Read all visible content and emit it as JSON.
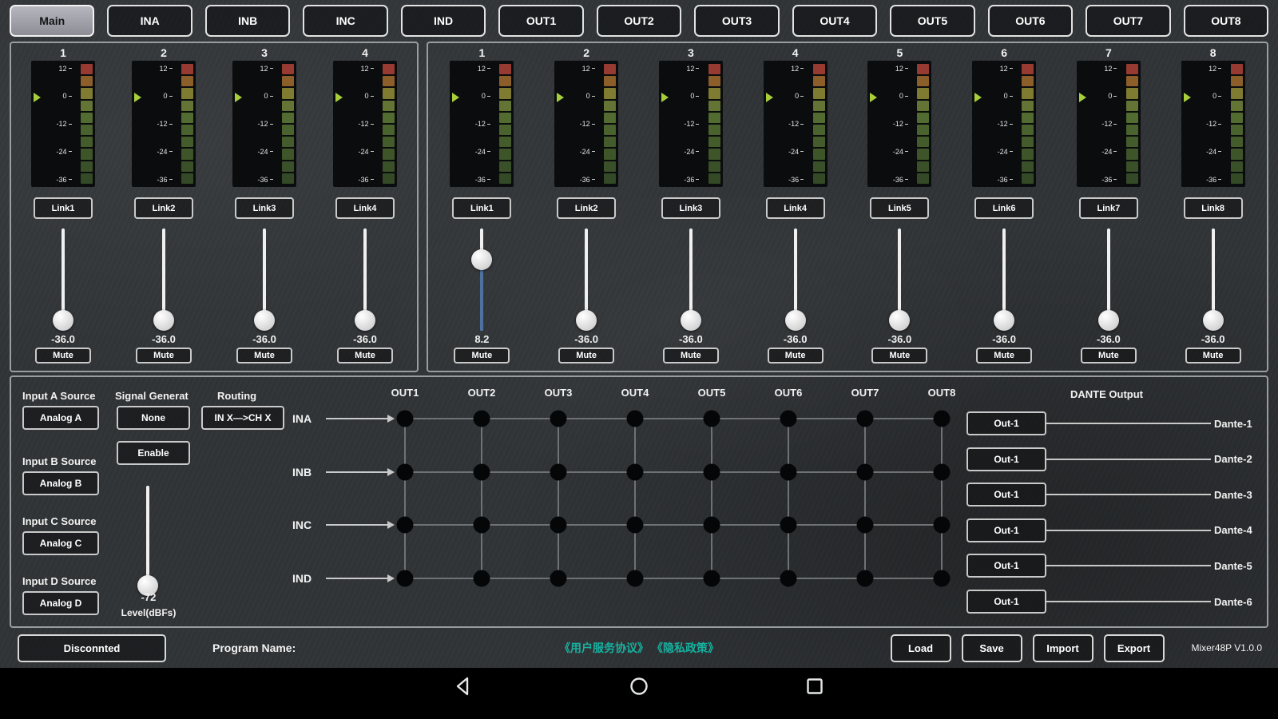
{
  "tabs": [
    {
      "label": "Main",
      "active": true
    },
    {
      "label": "INA"
    },
    {
      "label": "INB"
    },
    {
      "label": "INC"
    },
    {
      "label": "IND"
    },
    {
      "label": "OUT1"
    },
    {
      "label": "OUT2"
    },
    {
      "label": "OUT3"
    },
    {
      "label": "OUT4"
    },
    {
      "label": "OUT5"
    },
    {
      "label": "OUT6"
    },
    {
      "label": "OUT7"
    },
    {
      "label": "OUT8"
    }
  ],
  "meter": {
    "scale": [
      "12",
      "0",
      "-12",
      "-24",
      "-36"
    ],
    "arrow_color": "#a6ce39",
    "led_colors": [
      "#973a31",
      "#8c5e2a",
      "#7f7c31",
      "#637434",
      "#526b30",
      "#4a632e",
      "#445c2c",
      "#3e552a",
      "#395028",
      "#344a26"
    ]
  },
  "input_channels": [
    {
      "number": "1",
      "link": "Link1",
      "value": "-36.0",
      "mute": "Mute",
      "fader_pos": 0
    },
    {
      "number": "2",
      "link": "Link2",
      "value": "-36.0",
      "mute": "Mute",
      "fader_pos": 0
    },
    {
      "number": "3",
      "link": "Link3",
      "value": "-36.0",
      "mute": "Mute",
      "fader_pos": 0
    },
    {
      "number": "4",
      "link": "Link4",
      "value": "-36.0",
      "mute": "Mute",
      "fader_pos": 0
    }
  ],
  "output_channels": [
    {
      "number": "1",
      "link": "Link1",
      "value": "8.2",
      "mute": "Mute",
      "fader_pos": 0.75
    },
    {
      "number": "2",
      "link": "Link2",
      "value": "-36.0",
      "mute": "Mute",
      "fader_pos": 0
    },
    {
      "number": "3",
      "link": "Link3",
      "value": "-36.0",
      "mute": "Mute",
      "fader_pos": 0
    },
    {
      "number": "4",
      "link": "Link4",
      "value": "-36.0",
      "mute": "Mute",
      "fader_pos": 0
    },
    {
      "number": "5",
      "link": "Link5",
      "value": "-36.0",
      "mute": "Mute",
      "fader_pos": 0
    },
    {
      "number": "6",
      "link": "Link6",
      "value": "-36.0",
      "mute": "Mute",
      "fader_pos": 0
    },
    {
      "number": "7",
      "link": "Link7",
      "value": "-36.0",
      "mute": "Mute",
      "fader_pos": 0
    },
    {
      "number": "8",
      "link": "Link8",
      "value": "-36.0",
      "mute": "Mute",
      "fader_pos": 0
    }
  ],
  "controls": {
    "input_a_label": "Input A Source",
    "input_a_value": "Analog A",
    "signal_gen_label": "Signal Generat",
    "signal_gen_value": "None",
    "enable_label": "Enable",
    "routing_label": "Routing",
    "routing_value": "IN X—>CH X",
    "input_b_label": "Input B Source",
    "input_b_value": "Analog B",
    "input_c_label": "Input C Source",
    "input_c_value": "Analog C",
    "input_d_label": "Input D Source",
    "input_d_value": "Analog D",
    "gen_level_value": "-72",
    "gen_level_label": "Level(dBFs)",
    "gen_fader_pos": 0
  },
  "matrix": {
    "col_headers": [
      "OUT1",
      "OUT2",
      "OUT3",
      "OUT4",
      "OUT5",
      "OUT6",
      "OUT7",
      "OUT8"
    ],
    "row_labels": [
      "INA",
      "INB",
      "INC",
      "IND"
    ]
  },
  "dante": {
    "title": "DANTE Output",
    "rows": [
      {
        "button": "Out-1",
        "label": "Dante-1"
      },
      {
        "button": "Out-1",
        "label": "Dante-2"
      },
      {
        "button": "Out-1",
        "label": "Dante-3"
      },
      {
        "button": "Out-1",
        "label": "Dante-4"
      },
      {
        "button": "Out-1",
        "label": "Dante-5"
      },
      {
        "button": "Out-1",
        "label": "Dante-6"
      }
    ]
  },
  "bottom_bar": {
    "connection": "Disconnted",
    "program_label": "Program Name:",
    "agreement_links": "《用户服务协议》 《隐私政策》",
    "accent_color": "#17b1a0",
    "buttons": [
      "Load",
      "Save",
      "Import",
      "Export"
    ],
    "version": "Mixer48P V1.0.0"
  }
}
